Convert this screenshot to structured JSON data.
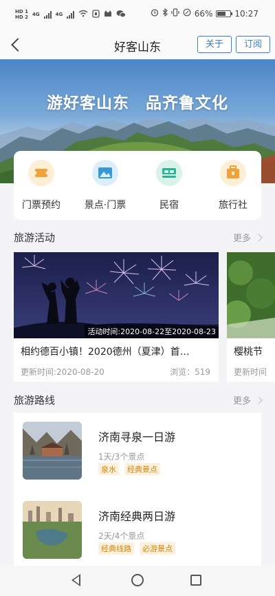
{
  "status_bar": {
    "sim1": "HD 1",
    "sim2": "HD 2",
    "sig1": "4G",
    "sig2": "4G",
    "icons_left": [
      "wifi-icon",
      "usb-icon",
      "cat-icon",
      "wechat-icon"
    ],
    "icons_right": [
      "alarm-icon",
      "bluetooth-icon",
      "vibrate-icon",
      "rotation-icon"
    ],
    "battery_level": 0.66,
    "battery": "66%",
    "time": "10:27"
  },
  "nav": {
    "title": "好客山东",
    "about_label": "关于",
    "subscribe_label": "订阅"
  },
  "banner": {
    "slogan": "游好客山东　品齐鲁文化"
  },
  "quick_nav": [
    {
      "label": "门票预约",
      "icon": "ticket-icon",
      "bg": "#fdeed5",
      "fg": "#f0a23a"
    },
    {
      "label": "景点·门票",
      "icon": "mountain-icon",
      "bg": "#dceefb",
      "fg": "#3a97d6"
    },
    {
      "label": "民宿",
      "icon": "bed-icon",
      "bg": "#d9f2ea",
      "fg": "#2bb493"
    },
    {
      "label": "旅行社",
      "icon": "luggage-icon",
      "bg": "#fdeed5",
      "fg": "#f0a23a"
    }
  ],
  "activities": {
    "title": "旅游活动",
    "more": "更多",
    "items": [
      {
        "title": "相约德百小镇！2020德州（夏津）首…",
        "time": "活动时间:2020-08-22至2020-08-23",
        "updated": "更新时间:2020-08-20",
        "views": "浏览：519"
      },
      {
        "title": "樱桃节",
        "updated": "更新时间"
      }
    ]
  },
  "routes": {
    "title": "旅游路线",
    "more": "更多",
    "items": [
      {
        "name": "济南寻泉一日游",
        "meta": "1天/3个景点",
        "tags": [
          "泉水",
          "经典景点"
        ]
      },
      {
        "name": "济南经典两日游",
        "meta": "2天/4个景点",
        "tags": [
          "经典线路",
          "必游景点"
        ]
      }
    ]
  },
  "system_nav": {
    "buttons": [
      "back-triangle-icon",
      "home-circle-icon",
      "recent-square-icon"
    ]
  }
}
